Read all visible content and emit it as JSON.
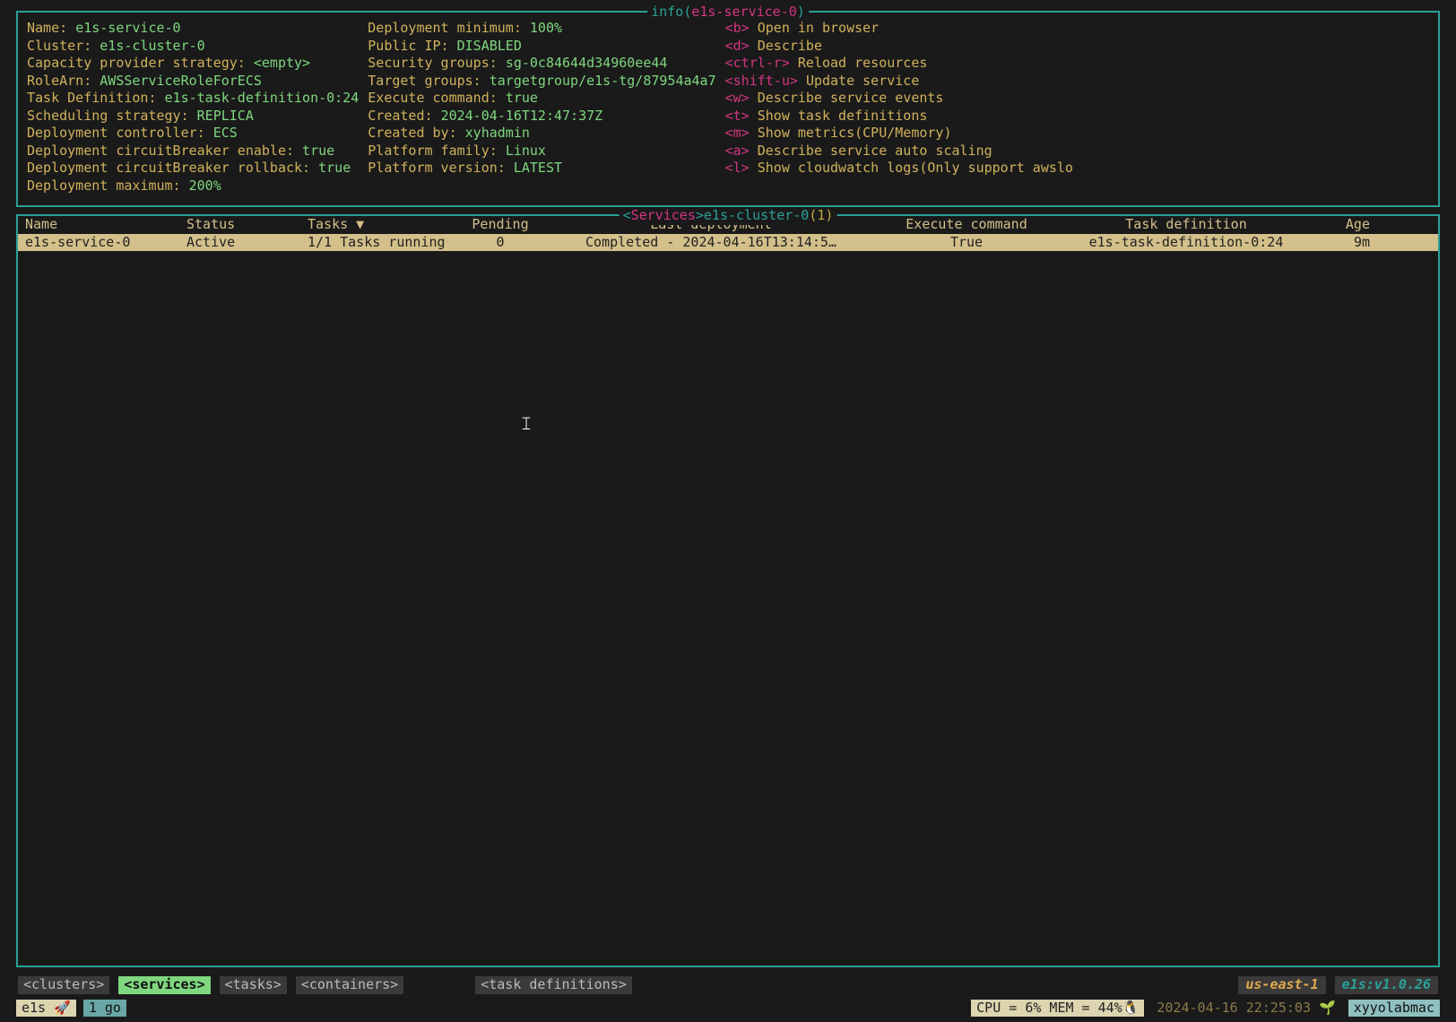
{
  "info": {
    "title_prefix": "info(",
    "title_name": "e1s-service-0",
    "title_suffix": ")",
    "col1": [
      {
        "k": "Name: ",
        "v": "e1s-service-0"
      },
      {
        "k": "Cluster: ",
        "v": "e1s-cluster-0"
      },
      {
        "k": "Capacity provider strategy: ",
        "v": "<empty>"
      },
      {
        "k": "RoleArn: ",
        "v": "AWSServiceRoleForECS"
      },
      {
        "k": "Task Definition: ",
        "v": "e1s-task-definition-0:24"
      },
      {
        "k": "Scheduling strategy: ",
        "v": "REPLICA"
      },
      {
        "k": "Deployment controller: ",
        "v": "ECS"
      },
      {
        "k": "Deployment circuitBreaker enable: ",
        "v": "true"
      },
      {
        "k": "Deployment circuitBreaker rollback: ",
        "v": "true"
      },
      {
        "k": "Deployment maximum: ",
        "v": "200%"
      }
    ],
    "col2": [
      {
        "k": "Deployment minimum: ",
        "v": "100%"
      },
      {
        "k": "Public IP: ",
        "v": "DISABLED"
      },
      {
        "k": "Security groups: ",
        "v": "sg-0c84644d34960ee44"
      },
      {
        "k": "Target groups: ",
        "v": "targetgroup/e1s-tg/87954a4a7"
      },
      {
        "k": "Execute command: ",
        "v": "true"
      },
      {
        "k": "Created: ",
        "v": "2024-04-16T12:47:37Z"
      },
      {
        "k": "Created by: ",
        "v": "xyhadmin"
      },
      {
        "k": "Platform family: ",
        "v": "Linux"
      },
      {
        "k": "Platform version: ",
        "v": "LATEST"
      }
    ],
    "col3": [
      {
        "key": "<b>",
        "act": "Open in browser"
      },
      {
        "key": "<d>",
        "act": "Describe"
      },
      {
        "key": "<ctrl-r>",
        "act": "Reload resources"
      },
      {
        "key": "<shift-u>",
        "act": "Update service"
      },
      {
        "key": "<w>",
        "act": "Describe service events"
      },
      {
        "key": "<t>",
        "act": "Show task definitions"
      },
      {
        "key": "<m>",
        "act": "Show metrics(CPU/Memory)"
      },
      {
        "key": "<a>",
        "act": "Describe service auto scaling"
      },
      {
        "key": "<l>",
        "act": "Show cloudwatch logs(Only support awslo"
      }
    ]
  },
  "services": {
    "title_prefix": "<",
    "title_word": "Services",
    "title_mid": ">",
    "title_cluster": "e1s-cluster-0",
    "title_count": "(1)",
    "headers": {
      "name": "Name",
      "status": "Status",
      "tasks": "Tasks ▼",
      "pending": "Pending",
      "last_deployment": "Last deployment",
      "exec": "Execute command",
      "taskdef": "Task definition",
      "age": "Age"
    },
    "row": {
      "name": "e1s-service-0",
      "status": "Active",
      "tasks": "1/1 Tasks running",
      "pending": "0",
      "last_deployment": "Completed - 2024-04-16T13:14:5…",
      "exec": "True",
      "taskdef": "e1s-task-definition-0:24",
      "age": "9m"
    }
  },
  "nav": {
    "clusters": "<clusters>",
    "services": "<services>",
    "tasks": "<tasks>",
    "containers": "<containers>",
    "taskdefs": "<task definitions>",
    "region": "us-east-1",
    "version": "e1s:v1.0.26"
  },
  "status": {
    "e1s_seg": "e1s 🚀",
    "go_seg": " 1 go ",
    "cpu": "CPU =  6% MEM = 44%🐧",
    "time": "2024-04-16 22:25:03 🌱",
    "host": " xyyolabmac "
  }
}
